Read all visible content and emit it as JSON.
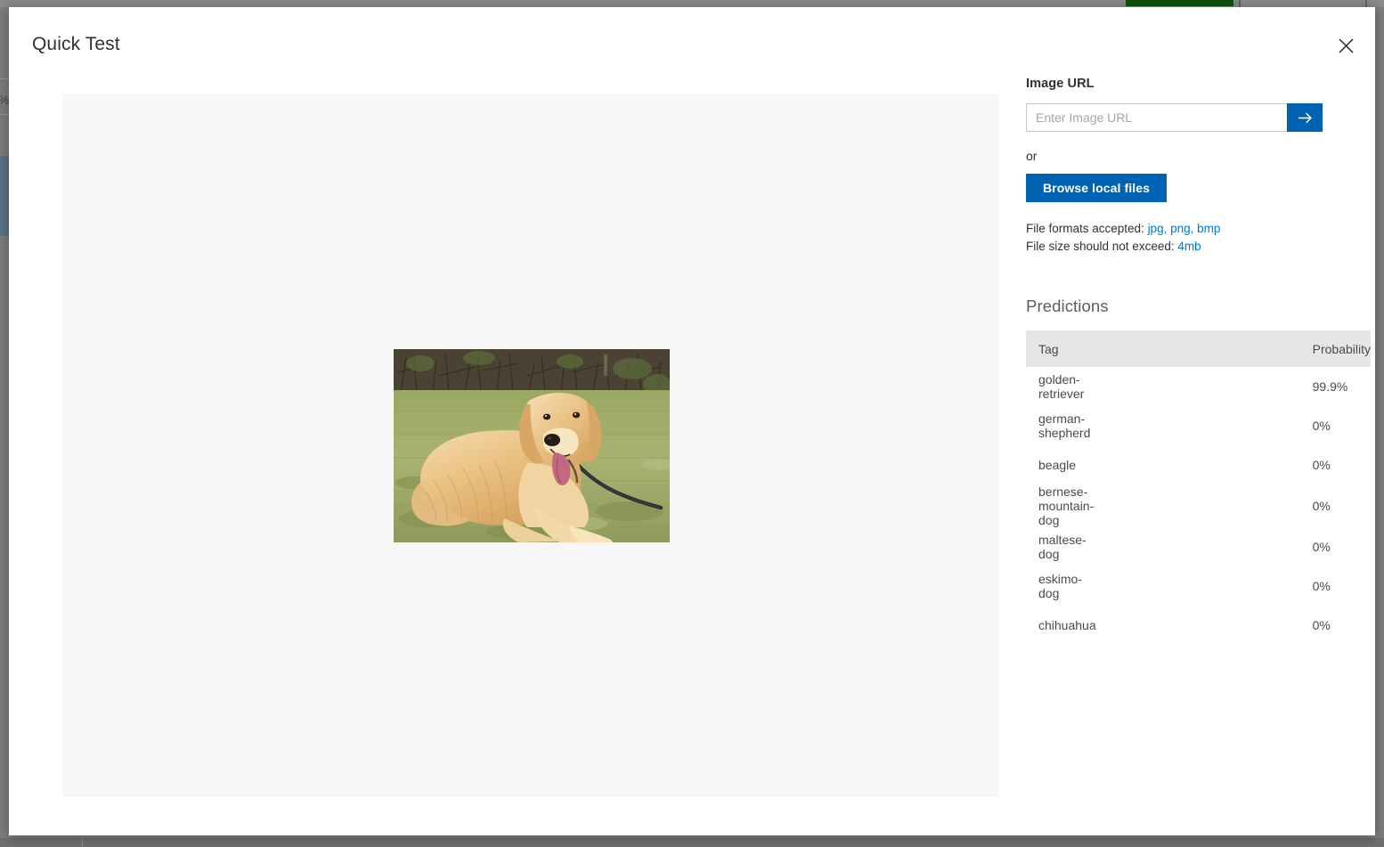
{
  "background": {
    "percent_fragment": "%",
    "green_bar_color": "#13520f",
    "overlay_color": "#7e7e7e"
  },
  "modal": {
    "title": "Quick Test",
    "close_label": "Close"
  },
  "preview": {
    "alt": "golden retriever dog lying on grass"
  },
  "side_panel": {
    "image_url_label": "Image URL",
    "url_placeholder": "Enter Image URL",
    "url_value": "",
    "go_button_label": "Submit URL",
    "or_label": "or",
    "browse_button_label": "Browse local files",
    "file_formats_prefix": "File formats accepted: ",
    "file_formats_value": "jpg, png, bmp",
    "file_size_prefix": "File size should not exceed: ",
    "file_size_value": "4mb",
    "accent_color": "#0078d4",
    "button_color": "#0063b1"
  },
  "predictions": {
    "heading": "Predictions",
    "columns": [
      "Tag",
      "Probability"
    ],
    "rows": [
      {
        "tag": "golden-retriever",
        "probability": "99.9%"
      },
      {
        "tag": "german-shepherd",
        "probability": "0%"
      },
      {
        "tag": "beagle",
        "probability": "0%"
      },
      {
        "tag": "bernese-mountain-dog",
        "probability": "0%"
      },
      {
        "tag": "maltese-dog",
        "probability": "0%"
      },
      {
        "tag": "eskimo-dog",
        "probability": "0%"
      },
      {
        "tag": "chihuahua",
        "probability": "0%"
      }
    ]
  }
}
